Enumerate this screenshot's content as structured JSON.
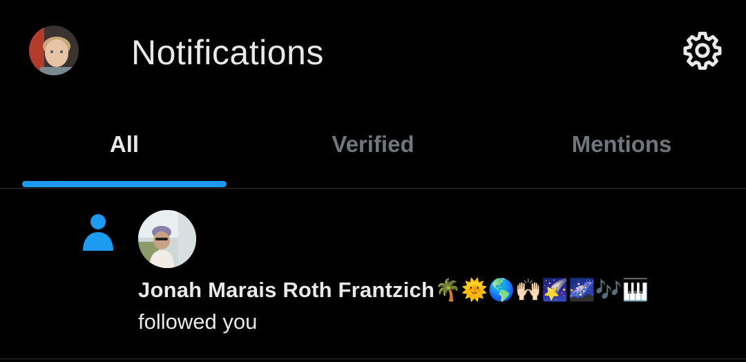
{
  "header": {
    "title": "Notifications",
    "profile_avatar_icon": "profile-avatar",
    "settings_icon": "gear-icon"
  },
  "tabs": [
    {
      "label": "All",
      "active": true
    },
    {
      "label": "Verified",
      "active": false
    },
    {
      "label": "Mentions",
      "active": false
    }
  ],
  "notification": {
    "type_icon": "person-icon",
    "user_name": "Jonah Marais Roth Frantzich🌴🌞🌎🙌🏻🌠🌌🎶🎹",
    "action": "followed you"
  },
  "colors": {
    "background": "#000000",
    "text_primary": "#e7e9ea",
    "text_secondary": "#71767b",
    "accent": "#1d9bf0",
    "divider": "#2f3336"
  }
}
